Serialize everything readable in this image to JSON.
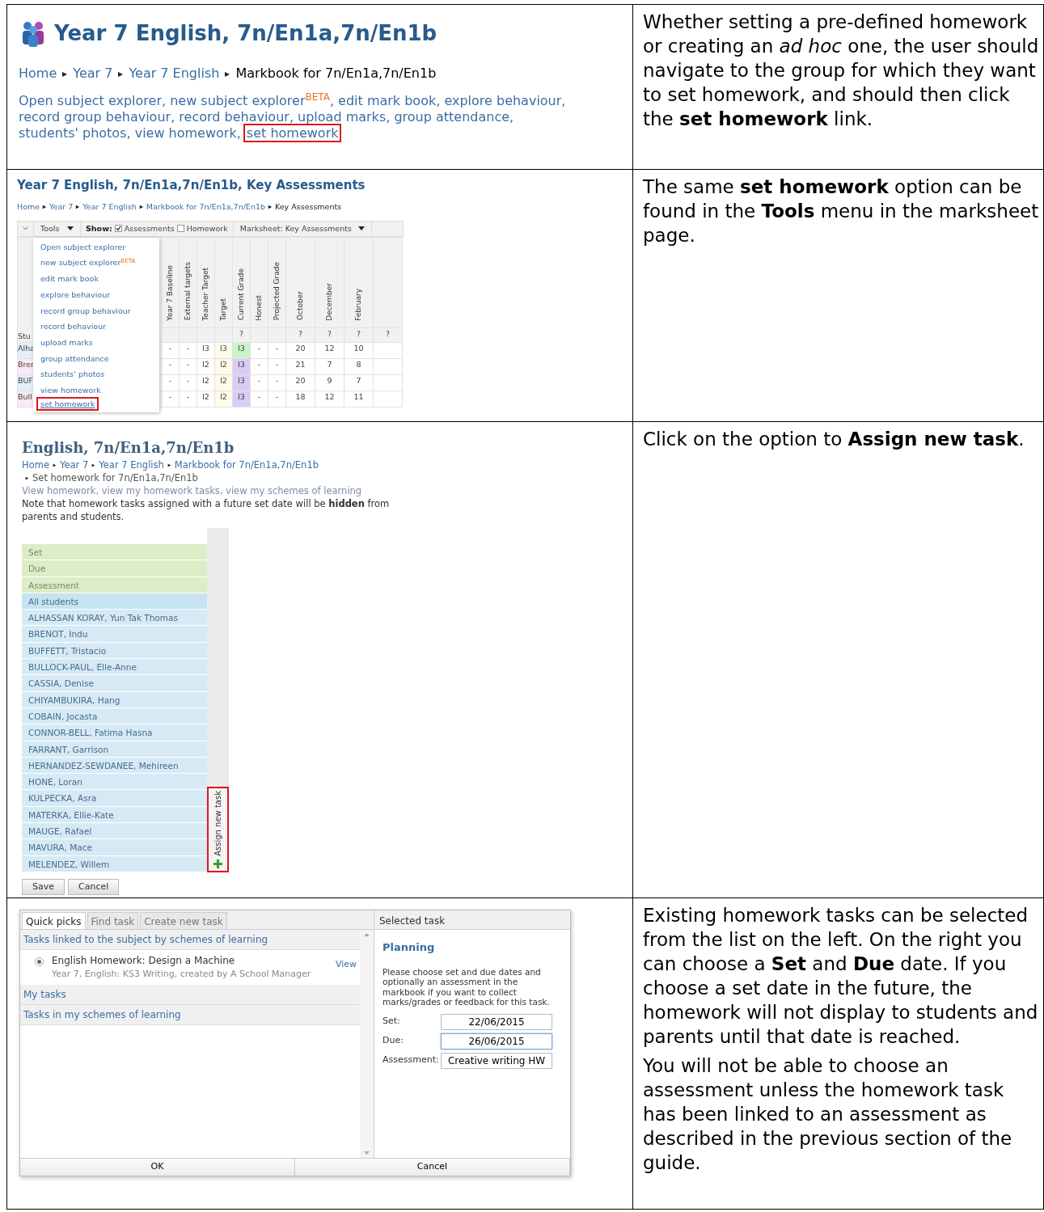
{
  "steps": [
    {
      "kind": "group_page",
      "screenshot": {
        "title": "Year 7 English, 7n/En1a,7n/En1b",
        "breadcrumbs": [
          {
            "text": "Home",
            "link": true
          },
          {
            "text": "Year 7",
            "link": true
          },
          {
            "text": "Year 7 English",
            "link": true
          },
          {
            "text": "Markbook for 7n/En1a,7n/En1b",
            "link": false
          }
        ],
        "links": [
          {
            "text": "Open subject explorer",
            "trail": ",",
            "highlighted": false
          },
          {
            "text": "new subject explorer",
            "sup": "BETA",
            "trail": ",",
            "highlighted": false
          },
          {
            "text": "edit mark book",
            "trail": ",",
            "highlighted": false
          },
          {
            "text": "explore behaviour",
            "trail": ",",
            "highlighted": false
          },
          {
            "text": "record group behaviour",
            "trail": ",",
            "highlighted": false
          },
          {
            "text": "record behaviour",
            "trail": ",",
            "highlighted": false
          },
          {
            "text": "upload marks",
            "trail": ",",
            "highlighted": false
          },
          {
            "text": "group attendance",
            "trail": ",",
            "highlighted": false
          },
          {
            "text": "students' photos",
            "trail": ",",
            "highlighted": false
          },
          {
            "text": "view homework",
            "trail": ",",
            "highlighted": false
          },
          {
            "text": "set homework",
            "highlighted": true
          }
        ]
      },
      "description": [
        "Whether setting a pre-defined homework or creating an *ad hoc* one, the user should navigate to the group for which they want to set homework, and should then click the **set homework** link."
      ]
    },
    {
      "kind": "marksheet",
      "screenshot": {
        "title": "Year 7 English, 7n/En1a,7n/En1b, Key Assessments",
        "breadcrumbs": [
          {
            "text": "Home",
            "link": true
          },
          {
            "text": "Year 7",
            "link": true
          },
          {
            "text": "Year 7 English",
            "link": true
          },
          {
            "text": "Markbook for 7n/En1a,7n/En1b",
            "link": true
          },
          {
            "text": "Key Assessments",
            "link": false
          }
        ],
        "toolbar": {
          "tools": "Tools",
          "show": "Show:",
          "checkboxes": [
            {
              "label": "Assessments",
              "checked": true
            },
            {
              "label": "Homework",
              "checked": false
            }
          ],
          "marksheet": "Marksheet: Key Assessments"
        },
        "menu": [
          {
            "text": "Open subject explorer",
            "highlighted": false
          },
          {
            "text": "new subject explorer",
            "sup": "BETA",
            "highlighted": false
          },
          {
            "text": "edit mark book",
            "highlighted": false
          },
          {
            "text": "explore behaviour",
            "highlighted": false
          },
          {
            "text": "record group behaviour",
            "highlighted": false
          },
          {
            "text": "record behaviour",
            "highlighted": false
          },
          {
            "text": "upload marks",
            "highlighted": false
          },
          {
            "text": "group attendance",
            "highlighted": false
          },
          {
            "text": "students' photos",
            "highlighted": false
          },
          {
            "text": "view homework",
            "highlighted": false
          },
          {
            "text": "set homework",
            "highlighted": true
          }
        ],
        "student_header": "Stu",
        "columns": [
          {
            "label": "Year 7 Baseline"
          },
          {
            "label": "External targets"
          },
          {
            "label": "Teacher Target"
          },
          {
            "label": "Target"
          },
          {
            "label": "Current Grade",
            "note": "?"
          },
          {
            "label": "Honest"
          },
          {
            "label": "Projected Grade"
          },
          {
            "label": "October",
            "note": "?"
          },
          {
            "label": "December",
            "note": "?"
          },
          {
            "label": "February",
            "note": "?"
          },
          {
            "note": "?"
          }
        ],
        "rows": [
          {
            "student": "Alha",
            "cells": [
              "-",
              "-",
              "I3",
              "I3",
              "I3",
              "-",
              "-",
              "20",
              "12",
              "10"
            ],
            "color": "#c8f5c8"
          },
          {
            "student": "Brer",
            "cells": [
              "-",
              "-",
              "I2",
              "I2",
              "I3",
              "-",
              "-",
              "21",
              "7",
              "8"
            ],
            "color": "#d9ccf7"
          },
          {
            "student": "BUF",
            "cells": [
              "-",
              "-",
              "I2",
              "I2",
              "I3",
              "-",
              "-",
              "20",
              "9",
              "7"
            ],
            "color": "#d9ccf7"
          },
          {
            "student": "Bull",
            "cells": [
              "-",
              "-",
              "I2",
              "I2",
              "I3",
              "-",
              "-",
              "18",
              "12",
              "11"
            ],
            "color": "#d9ccf7"
          }
        ]
      },
      "description": [
        "The same **set homework** option can be found in the **Tools** menu in the marksheet page."
      ]
    },
    {
      "kind": "set_homework",
      "screenshot": {
        "title": "English, 7n/En1a,7n/En1b",
        "breadcrumbs": [
          {
            "text": "Home",
            "link": true
          },
          {
            "text": "Year 7",
            "link": true
          },
          {
            "text": "Year 7 English",
            "link": true
          },
          {
            "text": "Markbook for 7n/En1a,7n/En1b",
            "link": true
          },
          {
            "text": "Set homework for 7n/En1a,7n/En1b",
            "link": false
          }
        ],
        "links": [
          {
            "text": "View homework",
            "trail": ","
          },
          {
            "text": "view my homework tasks",
            "trail": ","
          },
          {
            "text": "view my schemes of learning"
          }
        ],
        "note": "Note that homework tasks assigned with a future set date will be **hidden** from parents and students.",
        "list": [
          {
            "label": "Set",
            "kind": "field"
          },
          {
            "label": "Due",
            "kind": "field"
          },
          {
            "label": "Assessment",
            "kind": "field"
          },
          {
            "label": "All students",
            "kind": "all"
          },
          {
            "label": "ALHASSAN KORAY, Yun Tak Thomas",
            "kind": "student"
          },
          {
            "label": "BRENOT, Indu",
            "kind": "student"
          },
          {
            "label": "BUFFETT, Tristacio",
            "kind": "student"
          },
          {
            "label": "BULLOCK-PAUL, Elle-Anne",
            "kind": "student"
          },
          {
            "label": "CASSIA, Denise",
            "kind": "student"
          },
          {
            "label": "CHIYAMBUKIRA, Hang",
            "kind": "student"
          },
          {
            "label": "COBAIN, Jocasta",
            "kind": "student"
          },
          {
            "label": "CONNOR-BELL, Fatima Hasna",
            "kind": "student"
          },
          {
            "label": "FARRANT, Garrison",
            "kind": "student"
          },
          {
            "label": "HERNANDEZ-SEWDANEE, Mehireen",
            "kind": "student"
          },
          {
            "label": "HONE, Loran",
            "kind": "student"
          },
          {
            "label": "KULPECKA, Asra",
            "kind": "student"
          },
          {
            "label": "MATERKA, Ellie-Kate",
            "kind": "student"
          },
          {
            "label": "MAUGE, Rafael",
            "kind": "student"
          },
          {
            "label": "MAVURA, Mace",
            "kind": "student"
          },
          {
            "label": "MELENDEZ, Willem",
            "kind": "student"
          }
        ],
        "assign": {
          "label": "Assign new task",
          "highlighted": true
        },
        "buttons": [
          "Save",
          "Cancel"
        ]
      },
      "description": [
        "Click on the option to **Assign new task**."
      ]
    },
    {
      "kind": "task_dialog",
      "screenshot": {
        "tabs": [
          {
            "label": "Quick picks",
            "selected": true
          },
          {
            "label": "Find task",
            "selected": false
          },
          {
            "label": "Create new task",
            "selected": false
          }
        ],
        "sections": [
          {
            "title": "Tasks linked to the subject by schemes of learning",
            "items": [
              {
                "title": "English Homework: Design a Machine",
                "subtitle": "Year 7, English: KS3 Writing, created by A School Manager",
                "action": "View",
                "selected": true
              }
            ]
          },
          {
            "title": "My tasks"
          },
          {
            "title": "Tasks in my schemes of learning"
          }
        ],
        "panel": {
          "header": "Selected task",
          "heading": "Planning",
          "text": "Please choose set and due dates and optionally an assessment in the markbook if you want to collect marks/grades or feedback for this task.",
          "fields": [
            {
              "label": "Set:",
              "value": "22/06/2015",
              "focused": false
            },
            {
              "label": "Due:",
              "value": "26/06/2015",
              "focused": true
            },
            {
              "label": "Assessment:",
              "value": "Creative writing HW",
              "focused": false
            }
          ]
        },
        "buttons": [
          "OK",
          "Cancel"
        ]
      },
      "description": [
        "Existing homework tasks can be selected from the list on the left. On the right you can choose a **Set** and **Due** date. If you choose a set date in the future, the homework will not display to students and parents until that date is reached.",
        "You will not be able to choose an assessment unless the homework task has been linked to an assessment as described in the previous section of the guide."
      ]
    }
  ]
}
